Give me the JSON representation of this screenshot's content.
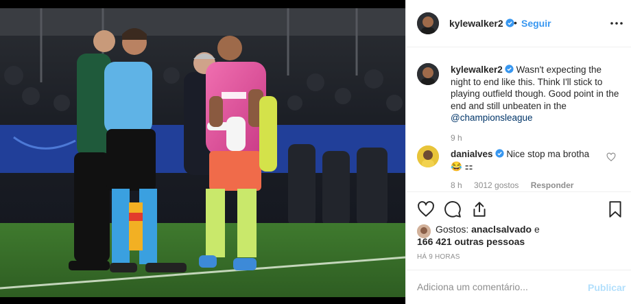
{
  "post": {
    "username": "kylewalker2",
    "follow_label": "Seguir",
    "dot": "•",
    "caption": {
      "username": "kylewalker2",
      "text": "Wasn't expecting the night to end like this. Think I'll stick to playing outfield though. Good point in the end and still unbeaten in the",
      "hashtag": "@championsleague",
      "time": "9 h"
    },
    "comment": {
      "username": "danialves",
      "text": "Nice stop ma brotha",
      "emoji": "😂 ⚏",
      "time": "8 h",
      "likes": "3012 gostos",
      "reply_label": "Responder"
    },
    "likes": {
      "prefix": "Gostos:",
      "user": "anaclsalvado",
      "conj": "e",
      "others": "166 421 outras pessoas"
    },
    "ago": "HÁ 9 HORAS",
    "add_comment_placeholder": "Adiciona um comentário...",
    "publish_label": "Publicar"
  },
  "colors": {
    "link_blue": "#3897f0",
    "publish_disabled": "#b2dffc",
    "muted": "#8e8e8e",
    "pink_jersey": "#e8509a",
    "referee_blue": "#5fb3e6"
  },
  "icons": [
    "verified-icon",
    "more-icon",
    "heart-icon",
    "comment-icon",
    "share-icon",
    "bookmark-icon"
  ]
}
